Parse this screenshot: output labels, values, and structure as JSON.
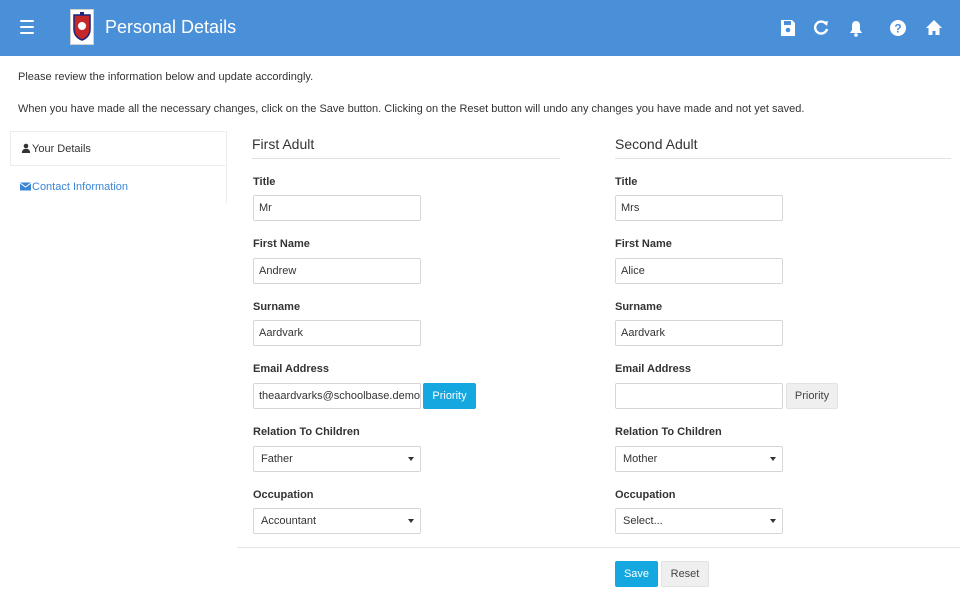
{
  "header": {
    "title": "Personal Details"
  },
  "intro": {
    "line1": "Please review the information below and update accordingly.",
    "line2": "When you have made all the necessary changes, click on the Save button. Clicking on the Reset button will undo any changes you have made and not yet saved."
  },
  "sidebar": {
    "items": [
      {
        "label": "Your Details",
        "active": true
      },
      {
        "label": "Contact Information",
        "active": false
      }
    ]
  },
  "labels": {
    "title": "Title",
    "first_name": "First Name",
    "surname": "Surname",
    "email": "Email Address",
    "relation": "Relation To Children",
    "occupation": "Occupation",
    "priority": "Priority"
  },
  "first_adult": {
    "heading": "First Adult",
    "title": "Mr",
    "first_name": "Andrew",
    "surname": "Aardvark",
    "email": "theaardvarks@schoolbase.demo",
    "relation": "Father",
    "occupation": "Accountant"
  },
  "second_adult": {
    "heading": "Second Adult",
    "title": "Mrs",
    "first_name": "Alice",
    "surname": "Aardvark",
    "email": "",
    "relation": "Mother",
    "occupation": "Select..."
  },
  "actions": {
    "save": "Save",
    "reset": "Reset"
  },
  "colors": {
    "header": "#4a90d9",
    "primary_button": "#14a7e0",
    "link": "#3a87d6"
  },
  "icons": [
    "menu-icon",
    "school-crest-icon",
    "save-icon",
    "refresh-icon",
    "bell-icon",
    "help-icon",
    "home-icon",
    "user-icon",
    "envelope-icon"
  ]
}
